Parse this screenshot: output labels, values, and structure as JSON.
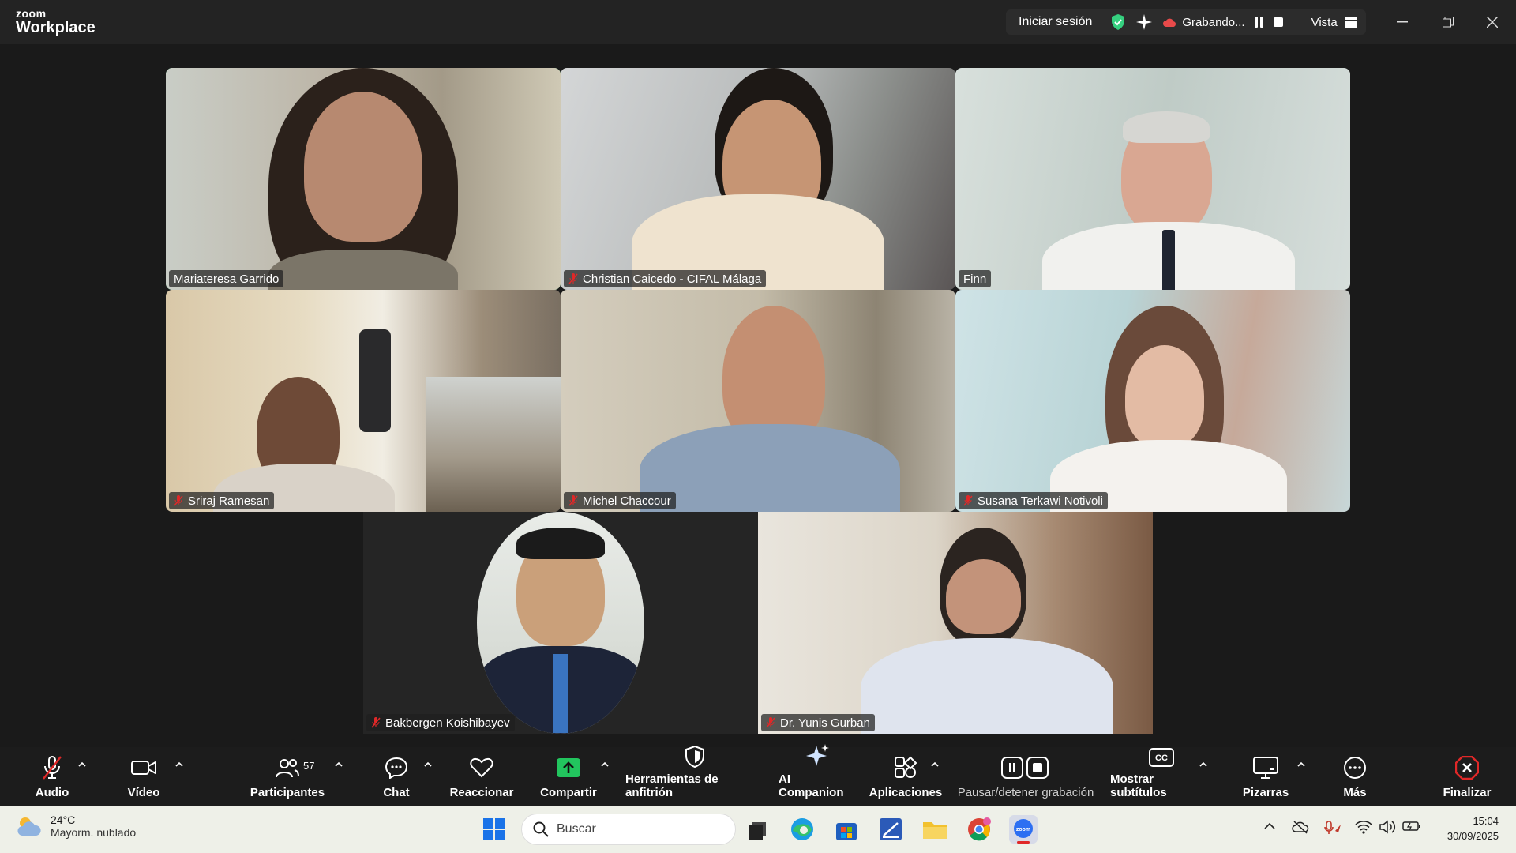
{
  "app": {
    "logo_top": "zoom",
    "logo_bottom": "Workplace"
  },
  "titlebar": {
    "signin": "Iniciar sesión",
    "recording_label": "Grabando...",
    "view_label": "Vista"
  },
  "tiles": [
    {
      "name": "Mariateresa Garrido",
      "muted": false,
      "active": true
    },
    {
      "name": "Christian Caicedo - CIFAL Málaga",
      "muted": true
    },
    {
      "name": "Finn",
      "muted": false
    },
    {
      "name": "Sriraj Ramesan",
      "muted": true
    },
    {
      "name": "Michel Chaccour",
      "muted": true
    },
    {
      "name": "Susana Terkawi Notivoli",
      "muted": true
    },
    {
      "name": "Bakbergen Koishibayev",
      "muted": true
    },
    {
      "name": "Dr. Yunis Gurban",
      "muted": true
    }
  ],
  "toolbar": {
    "audio": "Audio",
    "video": "Vídeo",
    "participants": "Participantes",
    "participants_count": "57",
    "chat": "Chat",
    "react": "Reaccionar",
    "share": "Compartir",
    "host_tools": "Herramientas de anfitrión",
    "ai_companion": "AI Companion",
    "apps": "Aplicaciones",
    "pause_record": "Pausar/detener grabación",
    "captions": "Mostrar subtítulos",
    "whiteboards": "Pizarras",
    "more": "Más",
    "end": "Finalizar"
  },
  "taskbar": {
    "temperature": "24°C",
    "weather": "Mayorm. nublado",
    "search_placeholder": "Buscar",
    "time": "15:04",
    "date": "30/09/2025"
  },
  "colors": {
    "active_speaker": "#35d07f",
    "end_button": "#e02828",
    "share_green": "#22c55e",
    "muted_red": "#e02828"
  }
}
